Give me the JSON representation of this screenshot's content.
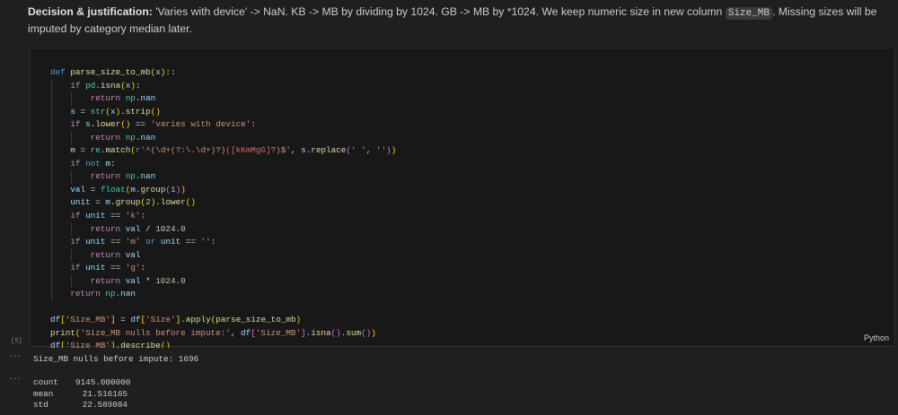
{
  "markdown": {
    "bold": "Decision & justification:",
    "text_before": " 'Varies with device' -> NaN. KB -> MB by dividing by 1024. GB -> MB by *1024. We keep numeric size in new column ",
    "code": "Size_MB",
    "text_after": ". Missing sizes will be imputed by category median later."
  },
  "cell": {
    "execution_count": "[5]",
    "language": "Python",
    "lines": [
      {
        "indent": 0,
        "tokens": [
          [
            "def",
            "d"
          ],
          [
            " ",
            "p"
          ],
          [
            "parse_size_to_mb",
            "f"
          ],
          [
            "(",
            "b1"
          ],
          [
            "x",
            "v"
          ],
          [
            "):",
            "b1"
          ],
          [
            ":",
            "p"
          ]
        ]
      },
      {
        "indent": 1,
        "tokens": [
          [
            "if",
            "k"
          ],
          [
            " ",
            "p"
          ],
          [
            "pd",
            "m"
          ],
          [
            ".",
            "p"
          ],
          [
            "isna",
            "f"
          ],
          [
            "(",
            "b1"
          ],
          [
            "x",
            "v"
          ],
          [
            ")",
            "b1"
          ],
          [
            ":",
            "p"
          ]
        ]
      },
      {
        "indent": 2,
        "tokens": [
          [
            "return",
            "k"
          ],
          [
            " ",
            "p"
          ],
          [
            "np",
            "m"
          ],
          [
            ".",
            "p"
          ],
          [
            "nan",
            "v"
          ]
        ]
      },
      {
        "indent": 1,
        "tokens": [
          [
            "s",
            "v"
          ],
          [
            " = ",
            "p"
          ],
          [
            "str",
            "m"
          ],
          [
            "(",
            "b1"
          ],
          [
            "x",
            "v"
          ],
          [
            ")",
            "b1"
          ],
          [
            ".",
            "p"
          ],
          [
            "strip",
            "f"
          ],
          [
            "()",
            "b1"
          ]
        ]
      },
      {
        "indent": 1,
        "tokens": [
          [
            "if",
            "k"
          ],
          [
            " ",
            "p"
          ],
          [
            "s",
            "v"
          ],
          [
            ".",
            "p"
          ],
          [
            "lower",
            "f"
          ],
          [
            "()",
            "b1"
          ],
          [
            " == ",
            "p"
          ],
          [
            "'varies with device'",
            "s"
          ],
          [
            ":",
            "p"
          ]
        ]
      },
      {
        "indent": 2,
        "tokens": [
          [
            "return",
            "k"
          ],
          [
            " ",
            "p"
          ],
          [
            "np",
            "m"
          ],
          [
            ".",
            "p"
          ],
          [
            "nan",
            "v"
          ]
        ]
      },
      {
        "indent": 1,
        "tokens": [
          [
            "m",
            "v"
          ],
          [
            " = ",
            "p"
          ],
          [
            "re",
            "m"
          ],
          [
            ".",
            "p"
          ],
          [
            "match",
            "f"
          ],
          [
            "(",
            "b1"
          ],
          [
            "r'",
            "d"
          ],
          [
            "^(\\d+(?:\\.\\d+)?)",
            "s"
          ],
          [
            "([kKmMgG]",
            "r"
          ],
          [
            "?)$'",
            "s"
          ],
          [
            ", ",
            "p"
          ],
          [
            "s",
            "v"
          ],
          [
            ".",
            "p"
          ],
          [
            "replace",
            "f"
          ],
          [
            "(",
            "b2"
          ],
          [
            "' '",
            "s"
          ],
          [
            ", ",
            "p"
          ],
          [
            "''",
            "s"
          ],
          [
            ")",
            "b2"
          ],
          [
            ")",
            "b1"
          ]
        ]
      },
      {
        "indent": 1,
        "tokens": [
          [
            "if",
            "k"
          ],
          [
            " ",
            "p"
          ],
          [
            "not",
            "d"
          ],
          [
            " ",
            "p"
          ],
          [
            "m",
            "v"
          ],
          [
            ":",
            "p"
          ]
        ]
      },
      {
        "indent": 2,
        "tokens": [
          [
            "return",
            "k"
          ],
          [
            " ",
            "p"
          ],
          [
            "np",
            "m"
          ],
          [
            ".",
            "p"
          ],
          [
            "nan",
            "v"
          ]
        ]
      },
      {
        "indent": 1,
        "tokens": [
          [
            "val",
            "v"
          ],
          [
            " = ",
            "p"
          ],
          [
            "float",
            "m"
          ],
          [
            "(",
            "b1"
          ],
          [
            "m",
            "v"
          ],
          [
            ".",
            "p"
          ],
          [
            "group",
            "f"
          ],
          [
            "(",
            "b2"
          ],
          [
            "1",
            "n"
          ],
          [
            ")",
            "b2"
          ],
          [
            ")",
            "b1"
          ]
        ]
      },
      {
        "indent": 1,
        "tokens": [
          [
            "unit",
            "v"
          ],
          [
            " = ",
            "p"
          ],
          [
            "m",
            "v"
          ],
          [
            ".",
            "p"
          ],
          [
            "group",
            "f"
          ],
          [
            "(",
            "b1"
          ],
          [
            "2",
            "n"
          ],
          [
            ")",
            "b1"
          ],
          [
            ".",
            "p"
          ],
          [
            "lower",
            "f"
          ],
          [
            "()",
            "b1"
          ]
        ]
      },
      {
        "indent": 1,
        "tokens": [
          [
            "if",
            "k"
          ],
          [
            " ",
            "p"
          ],
          [
            "unit",
            "v"
          ],
          [
            " == ",
            "p"
          ],
          [
            "'k'",
            "s"
          ],
          [
            ":",
            "p"
          ]
        ]
      },
      {
        "indent": 2,
        "tokens": [
          [
            "return",
            "k"
          ],
          [
            " ",
            "p"
          ],
          [
            "val",
            "v"
          ],
          [
            " / ",
            "p"
          ],
          [
            "1024.0",
            "n"
          ]
        ]
      },
      {
        "indent": 1,
        "tokens": [
          [
            "if",
            "k"
          ],
          [
            " ",
            "p"
          ],
          [
            "unit",
            "v"
          ],
          [
            " == ",
            "p"
          ],
          [
            "'m'",
            "s"
          ],
          [
            " ",
            "p"
          ],
          [
            "or",
            "d"
          ],
          [
            " ",
            "p"
          ],
          [
            "unit",
            "v"
          ],
          [
            " == ",
            "p"
          ],
          [
            "''",
            "s"
          ],
          [
            ":",
            "p"
          ]
        ]
      },
      {
        "indent": 2,
        "tokens": [
          [
            "return",
            "k"
          ],
          [
            " ",
            "p"
          ],
          [
            "val",
            "v"
          ]
        ]
      },
      {
        "indent": 1,
        "tokens": [
          [
            "if",
            "k"
          ],
          [
            " ",
            "p"
          ],
          [
            "unit",
            "v"
          ],
          [
            " == ",
            "p"
          ],
          [
            "'g'",
            "s"
          ],
          [
            ":",
            "p"
          ]
        ]
      },
      {
        "indent": 2,
        "tokens": [
          [
            "return",
            "k"
          ],
          [
            " ",
            "p"
          ],
          [
            "val",
            "v"
          ],
          [
            " * ",
            "p"
          ],
          [
            "1024.0",
            "n"
          ]
        ]
      },
      {
        "indent": 1,
        "tokens": [
          [
            "return",
            "k"
          ],
          [
            " ",
            "p"
          ],
          [
            "np",
            "m"
          ],
          [
            ".",
            "p"
          ],
          [
            "nan",
            "v"
          ]
        ]
      },
      {
        "indent": 0,
        "tokens": []
      },
      {
        "indent": 0,
        "tokens": [
          [
            "df",
            "v"
          ],
          [
            "[",
            "b1"
          ],
          [
            "'Size_MB'",
            "s"
          ],
          [
            "]",
            "b1"
          ],
          [
            " = ",
            "p"
          ],
          [
            "df",
            "v"
          ],
          [
            "[",
            "b1"
          ],
          [
            "'Size'",
            "s"
          ],
          [
            "]",
            "b1"
          ],
          [
            ".",
            "p"
          ],
          [
            "apply",
            "f"
          ],
          [
            "(",
            "b1"
          ],
          [
            "parse_size_to_mb",
            "f"
          ],
          [
            ")",
            "b1"
          ]
        ]
      },
      {
        "indent": 0,
        "tokens": [
          [
            "print",
            "f"
          ],
          [
            "(",
            "b1"
          ],
          [
            "'Size_MB nulls before impute:'",
            "s"
          ],
          [
            ", ",
            "p"
          ],
          [
            "df",
            "v"
          ],
          [
            "[",
            "b2"
          ],
          [
            "'Size_MB'",
            "s"
          ],
          [
            "]",
            "b2"
          ],
          [
            ".",
            "p"
          ],
          [
            "isna",
            "f"
          ],
          [
            "()",
            "b2"
          ],
          [
            ".",
            "p"
          ],
          [
            "sum",
            "f"
          ],
          [
            "()",
            "b2"
          ],
          [
            ")",
            "b1"
          ]
        ]
      },
      {
        "indent": 0,
        "tokens": [
          [
            "df",
            "v"
          ],
          [
            "[",
            "b1"
          ],
          [
            "'Size_MB'",
            "s"
          ],
          [
            "]",
            "b1"
          ],
          [
            ".",
            "p"
          ],
          [
            "describe",
            "f"
          ],
          [
            "()",
            "b1"
          ]
        ]
      }
    ]
  },
  "output": {
    "stdout": "Size_MB nulls before impute: 1696",
    "describe": [
      {
        "label": "count",
        "value": "9145.000000"
      },
      {
        "label": "mean",
        "value": "21.516165"
      },
      {
        "label": "std",
        "value": "22.589084"
      }
    ]
  }
}
